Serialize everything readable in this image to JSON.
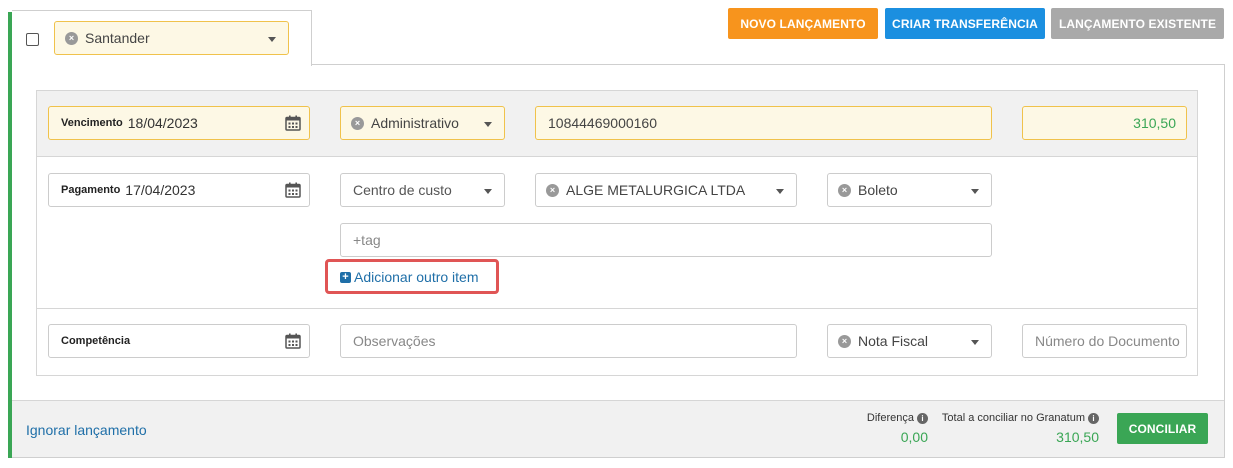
{
  "account": {
    "selected": "Santander"
  },
  "actions": {
    "novo_lancamento": "NOVO LANÇAMENTO",
    "criar_transferencia": "CRIAR TRANSFERÊNCIA",
    "lancamento_existente": "LANÇAMENTO EXISTENTE"
  },
  "row1": {
    "vencimento_label": "Vencimento",
    "vencimento_value": "18/04/2023",
    "categoria": "Administrativo",
    "document_id": "10844469000160",
    "valor": "310,50"
  },
  "row2": {
    "pagamento_label": "Pagamento",
    "pagamento_value": "17/04/2023",
    "centro_custo_placeholder": "Centro de custo",
    "fornecedor": "ALGE METALURGICA LTDA",
    "forma_pagamento": "Boleto",
    "tag_placeholder": "+tag",
    "add_item": "Adicionar outro item"
  },
  "row3": {
    "competencia_label": "Competência",
    "observacoes_placeholder": "Observações",
    "tipo_documento": "Nota Fiscal",
    "numero_documento_placeholder": "Número do Documento"
  },
  "footer": {
    "ignorar": "Ignorar lançamento",
    "diferenca_label": "Diferença",
    "diferenca_value": "0,00",
    "total_label": "Total a conciliar no Granatum",
    "total_value": "310,50",
    "conciliar": "CONCILIAR"
  },
  "colors": {
    "orange": "#f7941d",
    "blue": "#1b8fe0",
    "gray": "#a9a9a9",
    "green": "#3aa655",
    "highlight": "#e05555",
    "link": "#1f6fa8"
  }
}
